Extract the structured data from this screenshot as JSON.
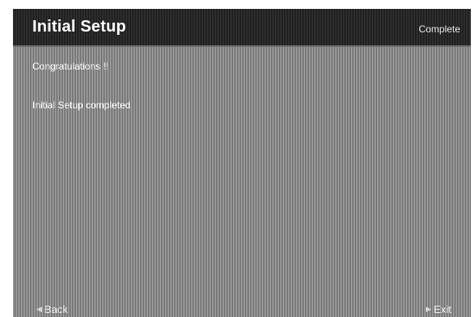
{
  "header": {
    "title": "Initial Setup",
    "step": "Complete"
  },
  "content": {
    "line1": "Congratulations !!",
    "line2": "Initial Setup completed"
  },
  "footer": {
    "back_label": "Back",
    "back_icon": "left-triangle",
    "exit_label": "Exit",
    "exit_icon": "right-triangle"
  },
  "colors": {
    "header_bg": "#141414",
    "panel_bg": "#8a8a8a",
    "text": "#ffffff"
  }
}
